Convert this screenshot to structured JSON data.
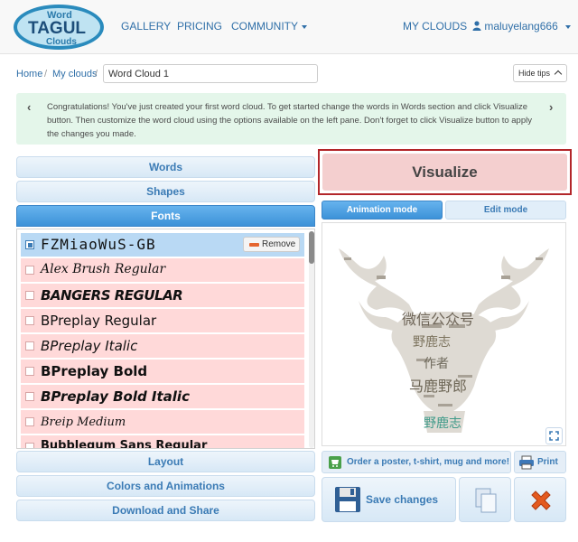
{
  "nav": {
    "logo": {
      "word": "Word",
      "tagul": "TAGUL",
      "clouds": "Clouds"
    },
    "gallery": "GALLERY",
    "pricing": "PRICING",
    "community": "COMMUNITY",
    "my_clouds": "MY CLOUDS",
    "username": "maluyelang666"
  },
  "breadcrumb": {
    "home": "Home",
    "sep": "/",
    "my_clouds": "My clouds",
    "cloud_name": "Word Cloud 1"
  },
  "hide_tips": "Hide tips",
  "tip": {
    "text": "Congratulations! You've just created your first word cloud. To get started change the words in Words section and click Visualize button. Then customize the word cloud using the options available on the left pane. Don't forget to click Visualize button to apply the changes you made."
  },
  "sections": {
    "words": "Words",
    "shapes": "Shapes",
    "fonts": "Fonts",
    "layout": "Layout",
    "colors": "Colors and Animations",
    "download": "Download and Share"
  },
  "fonts": {
    "remove_label": "Remove",
    "items": [
      {
        "name": "FZMiaoWuS-GB",
        "selected": true
      },
      {
        "name": "Alex Brush Regular",
        "selected": false
      },
      {
        "name": "BANGERS REGULAR",
        "selected": false
      },
      {
        "name": "BPreplay Regular",
        "selected": false
      },
      {
        "name": "BPreplay Italic",
        "selected": false
      },
      {
        "name": "BPreplay Bold",
        "selected": false
      },
      {
        "name": "BPreplay Bold Italic",
        "selected": false
      },
      {
        "name": "Breip Medium",
        "selected": false
      },
      {
        "name": "Bubblegum Sans Regular",
        "selected": false
      }
    ]
  },
  "visualize": "Visualize",
  "modes": {
    "animation": "Animation mode",
    "edit": "Edit mode"
  },
  "cloud_words": {
    "w1": "微信公众号",
    "w2": "野鹿志",
    "w3": "作者",
    "w4": "马鹿野郎",
    "w5": "野鹿志"
  },
  "actions": {
    "order": "Order a poster, t-shirt, mug and more!",
    "print": "Print",
    "save": "Save changes"
  },
  "colors": {
    "accent": "#3b7bb5",
    "selected_font": "#b9d9f4",
    "font_row": "#ffd9d9",
    "visualize_border": "#b3262a",
    "tip_bg": "#e4f6ea"
  }
}
